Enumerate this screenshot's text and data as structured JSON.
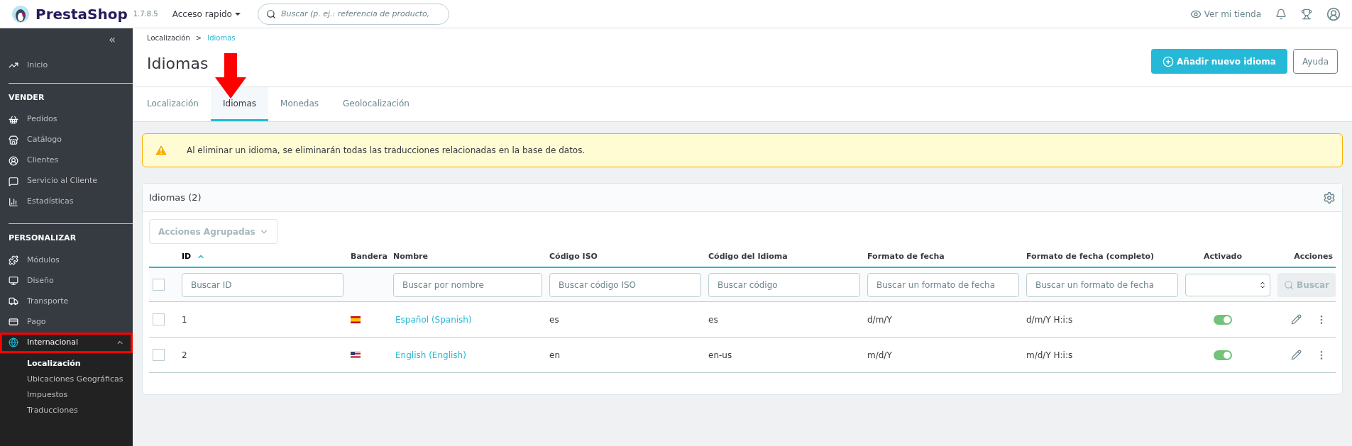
{
  "topbar": {
    "brand": "PrestaShop",
    "version": "1.7.8.5",
    "quick_access": "Acceso rapido",
    "search": {
      "placeholder": "Buscar (p. ej.: referencia de producto,"
    },
    "view_store": "Ver mi tienda"
  },
  "sidebar": {
    "collapse": "«",
    "home": "Inicio",
    "sections": [
      {
        "title": "VENDER",
        "items": [
          {
            "label": "Pedidos",
            "highlighted": false,
            "expanded": false
          },
          {
            "label": "Catálogo",
            "highlighted": false,
            "expanded": false
          },
          {
            "label": "Clientes",
            "highlighted": false,
            "expanded": false
          },
          {
            "label": "Servicio al Cliente",
            "highlighted": false,
            "expanded": false
          },
          {
            "label": "Estadísticas",
            "highlighted": false,
            "expanded": false
          }
        ]
      },
      {
        "title": "PERSONALIZAR",
        "items": [
          {
            "label": "Módulos",
            "highlighted": false,
            "expanded": false
          },
          {
            "label": "Diseño",
            "highlighted": false,
            "expanded": false
          },
          {
            "label": "Transporte",
            "highlighted": false,
            "expanded": false
          },
          {
            "label": "Pago",
            "highlighted": false,
            "expanded": false
          },
          {
            "label": "Internacional",
            "highlighted": true,
            "expanded": true,
            "children": [
              {
                "label": "Localización",
                "selected": true
              },
              {
                "label": "Ubicaciones Geográficas",
                "selected": false
              },
              {
                "label": "Impuestos",
                "selected": false
              },
              {
                "label": "Traducciones",
                "selected": false
              }
            ]
          }
        ]
      }
    ]
  },
  "breadcrumb": [
    {
      "label": "Localización",
      "current": false
    },
    {
      "label": "Idiomas",
      "current": true
    }
  ],
  "breadcrumb_separator": ">",
  "page_title": "Idiomas",
  "header_buttons": [
    {
      "label": "Añadir nuevo idioma",
      "kind": "primary"
    },
    {
      "label": "Ayuda",
      "kind": "outline"
    }
  ],
  "tabs": [
    {
      "label": "Localización",
      "selected": false
    },
    {
      "label": "Idiomas",
      "selected": true
    },
    {
      "label": "Monedas",
      "selected": false
    },
    {
      "label": "Geolocalización",
      "selected": false
    }
  ],
  "alert": "Al eliminar un idioma, se eliminarán todas las traducciones relacionadas en la base de datos.",
  "table": {
    "title": "Idiomas (2)",
    "bulk_actions": "Acciones Agrupadas",
    "columns": [
      {
        "label": "ID",
        "sorted": true
      },
      {
        "label": "Bandera",
        "sorted": false
      },
      {
        "label": "Nombre",
        "sorted": false
      },
      {
        "label": "Código ISO",
        "sorted": false
      },
      {
        "label": "Código del Idioma",
        "sorted": false
      },
      {
        "label": "Formato de fecha",
        "sorted": false
      },
      {
        "label": "Formato de fecha (completo)",
        "sorted": false
      },
      {
        "label": "Activado",
        "sorted": false
      },
      {
        "label": "Acciones",
        "sorted": false
      }
    ],
    "select_all_checked": false,
    "filters": [
      {
        "kind": "text",
        "placeholder": "Buscar ID"
      },
      {
        "kind": "none"
      },
      {
        "kind": "text",
        "placeholder": "Buscar por nombre"
      },
      {
        "kind": "text",
        "placeholder": "Buscar código ISO"
      },
      {
        "kind": "text",
        "placeholder": "Buscar código"
      },
      {
        "kind": "text",
        "placeholder": "Buscar un formato de fecha"
      },
      {
        "kind": "text",
        "placeholder": "Buscar un formato de fecha"
      }
    ],
    "search_button": "Buscar",
    "rows": [
      {
        "id": "1",
        "name": "Español (Spanish)",
        "iso": "es",
        "code": "es",
        "date": "d/m/Y",
        "date_full": "d/m/Y H:i:s",
        "checked": false,
        "active": true
      },
      {
        "id": "2",
        "name": "English (English)",
        "iso": "en",
        "code": "en-us",
        "date": "m/d/Y",
        "date_full": "m/d/Y H:i:s",
        "checked": false,
        "active": true
      }
    ]
  }
}
